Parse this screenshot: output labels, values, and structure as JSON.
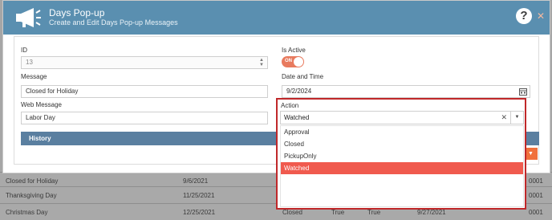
{
  "modal": {
    "title": "Days Pop-up",
    "subtitle": "Create and Edit Days Pop-up Messages",
    "help_icon": "question-circle-icon",
    "close_icon": "close-icon",
    "header_icon": "megaphone-icon",
    "accent_color": "#5a8fb0"
  },
  "form": {
    "id_label": "ID",
    "id_value": "13",
    "message_label": "Message",
    "message_value": "Closed for Holiday",
    "web_message_label": "Web Message",
    "web_message_value": "Labor Day",
    "is_active_label": "Is Active",
    "is_active_toggle": "ON",
    "date_label": "Date and Time",
    "date_value": "9/2/2024",
    "action_label": "Action",
    "action_value": "Watched",
    "history_label": "History"
  },
  "action_options": [
    "Approval",
    "Closed",
    "PickupOnly",
    "Watched"
  ],
  "action_selected_index": 3,
  "background_rows": [
    {
      "name": "Closed for Holiday",
      "date": "9/6/2021",
      "code": "0001"
    },
    {
      "name": "Thanksgiving Day",
      "date": "11/25/2021",
      "code": "0001"
    },
    {
      "name": "Christmas Day",
      "date": "12/25/2021",
      "status": "Closed",
      "active": "True",
      "flag": "True",
      "mod_date": "9/27/2021",
      "code": "0001"
    }
  ]
}
